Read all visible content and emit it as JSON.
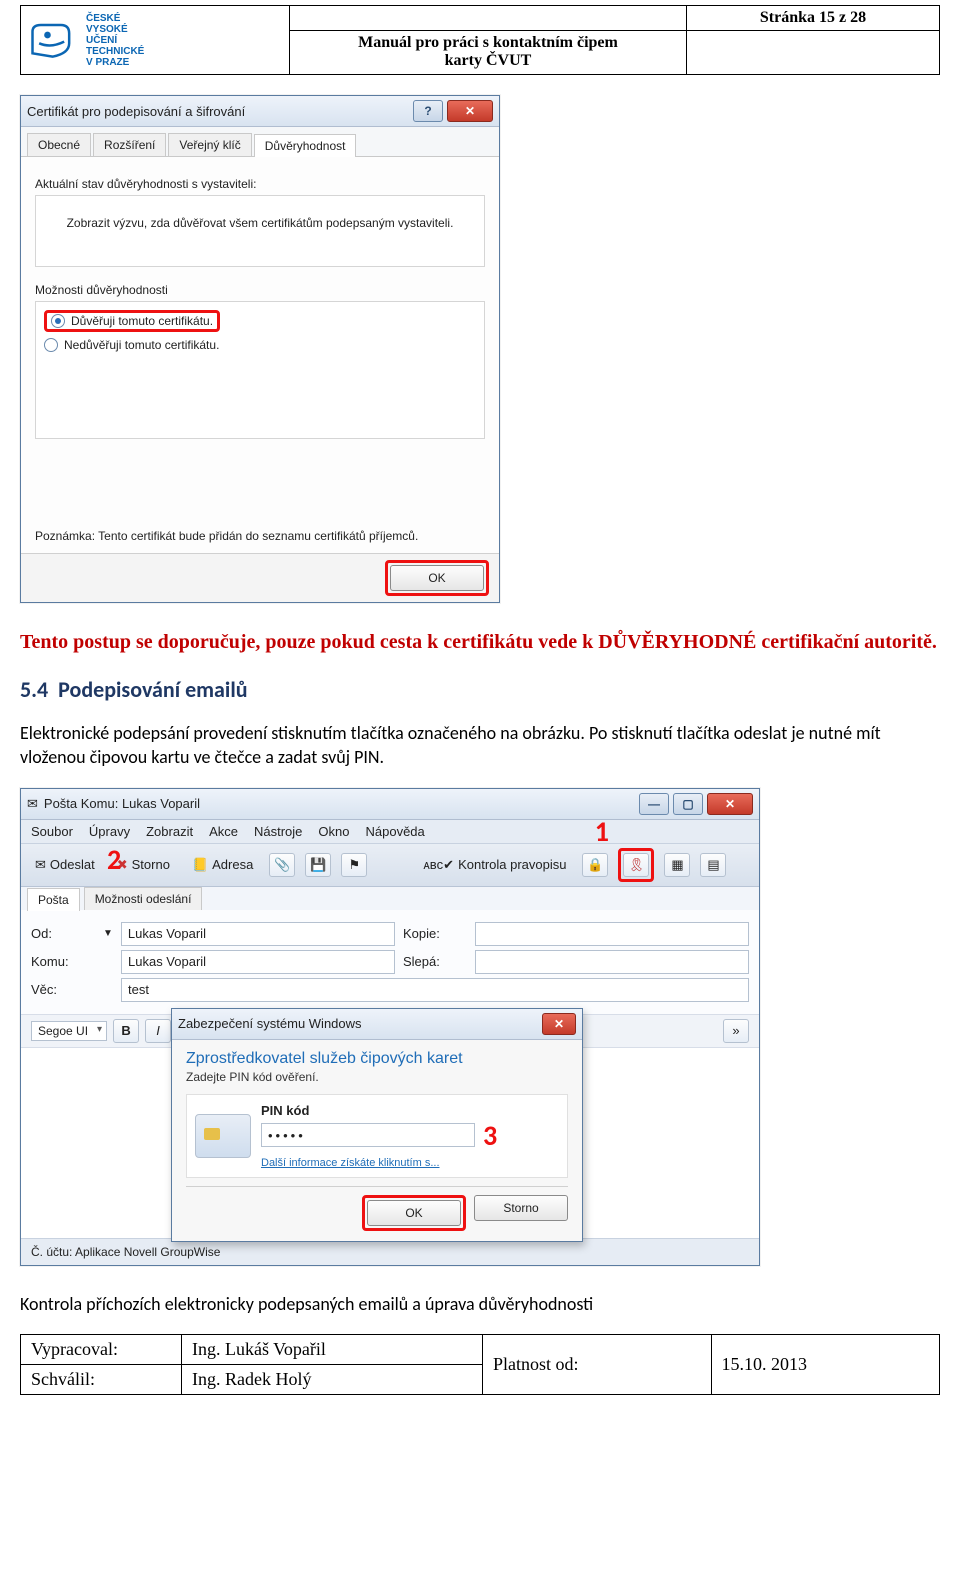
{
  "header": {
    "logo_text": "ČESKÉ\nVYSOKÉ\nUČENÍ\nTECHNICKÉ\nV PRAZE",
    "title_line1": "Manuál pro práci s kontaktním čipem",
    "title_line2": "karty ČVUT",
    "page_info": "Stránka 15 z 28"
  },
  "cert_dialog": {
    "title": "Certifikát pro podepisování a šifrování",
    "tabs": [
      "Obecné",
      "Rozšíření",
      "Veřejný klíč",
      "Důvěryhodnost"
    ],
    "active_tab_index": 3,
    "state_label": "Aktuální stav důvěryhodnosti s vystaviteli:",
    "state_text": "Zobrazit výzvu, zda důvěřovat všem certifikátům podepsaným vystaviteli.",
    "options_label": "Možnosti důvěryhodnosti",
    "radio_trust": "Důvěřuji tomuto certifikátu.",
    "radio_notrust": "Nedůvěřuji tomuto certifikátu.",
    "note": "Poznámka: Tento certifikát bude přidán do seznamu certifikátů příjemců.",
    "ok": "OK"
  },
  "text": {
    "warning": "Tento postup se doporučuje, pouze pokud cesta k certifikátu vede k DŮVĚRYHODNÉ certifikační autoritě.",
    "section_num": "5.4",
    "section_title": "Podepisování emailů",
    "paragraph": "Elektronické podepsání provedení stisknutím tlačítka označeného na obrázku. Po stisknutí tlačítka odeslat je nutné mít vloženou čipovou kartu ve čtečce a zadat svůj PIN.",
    "below_email": "Kontrola příchozích elektronicky podepsaných emailů a úprava důvěryhodnosti"
  },
  "email": {
    "window_title": "Pošta Komu: Lukas Voparil",
    "menu": [
      "Soubor",
      "Úpravy",
      "Zobrazit",
      "Akce",
      "Nástroje",
      "Okno",
      "Nápověda"
    ],
    "toolbar": {
      "send": "Odeslat",
      "cancel": "Storno",
      "address": "Adresa",
      "spell": "Kontrola pravopisu"
    },
    "subtabs": [
      "Pošta",
      "Možnosti odeslání"
    ],
    "labels": {
      "from": "Od:",
      "to": "Komu:",
      "cc": "Kopie:",
      "bcc": "Slepá:",
      "subject": "Věc:"
    },
    "values": {
      "from": "Lukas Voparil",
      "to": "Lukas Voparil",
      "cc": "",
      "bcc": "",
      "subject": "test"
    },
    "font": "Segoe UI",
    "statusbar": "Č. účtu: Aplikace Novell GroupWise",
    "annot": {
      "a1": "1",
      "a2": "2",
      "a3": "3"
    }
  },
  "pin_dialog": {
    "title": "Zabezpečení systému Windows",
    "heading": "Zprostředkovatel služeb čipových karet",
    "sub": "Zadejte PIN kód ověření.",
    "pin_label": "PIN kód",
    "pin_value": "•••••",
    "link": "Další informace získáte kliknutím s...",
    "ok": "OK",
    "cancel": "Storno"
  },
  "footer": {
    "row1_label": "Vypracoval:",
    "row1_value": "Ing. Lukáš Vopařil",
    "row2_label": "Schválil:",
    "row2_value": "Ing. Radek Holý",
    "valid_label": "Platnost od:",
    "valid_value": "15.10. 2013"
  }
}
